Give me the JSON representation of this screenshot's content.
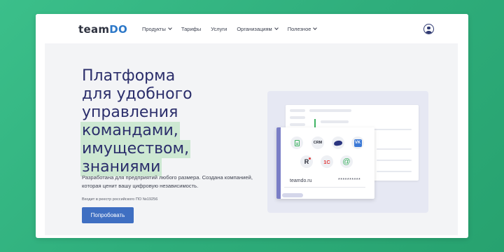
{
  "brand": {
    "logo_part1": "team",
    "logo_part2": "DO"
  },
  "nav": {
    "items": [
      {
        "label": "Продукты",
        "has_dropdown": true
      },
      {
        "label": "Тарифы",
        "has_dropdown": false
      },
      {
        "label": "Услуги",
        "has_dropdown": false
      },
      {
        "label": "Организациям",
        "has_dropdown": true
      },
      {
        "label": "Полезное",
        "has_dropdown": true
      }
    ],
    "user_icon": "user-circle-icon"
  },
  "hero": {
    "headline": {
      "line1": "Платформа",
      "line2": "для удобного",
      "line3": "управления",
      "line4": "командами,",
      "line5": "имуществом,",
      "line6": "знаниями"
    },
    "description": "Разработана для предприятий любого размера. Создана компанией, которая ценит вашу цифровую независимость.",
    "registry_note": "Входит в реестр российского ПО №19256",
    "cta_label": "Попробовать"
  },
  "illustration": {
    "icons": [
      "document-icon",
      "crm-icon",
      "hat-icon",
      "vk-icon",
      "r-icon",
      "1c-icon",
      "at-icon"
    ],
    "crm_label": "CRM",
    "vk_label": "VK",
    "r_label": "R",
    "onec_label": "1С",
    "at_label": "@",
    "domain": "teamdo.ru",
    "password": "**********"
  },
  "colors": {
    "background": "#33b682",
    "headline": "#2b2e6b",
    "highlight": "#cde8d2",
    "button": "#3f6fc2",
    "accent_logo": "#2d78c8"
  }
}
